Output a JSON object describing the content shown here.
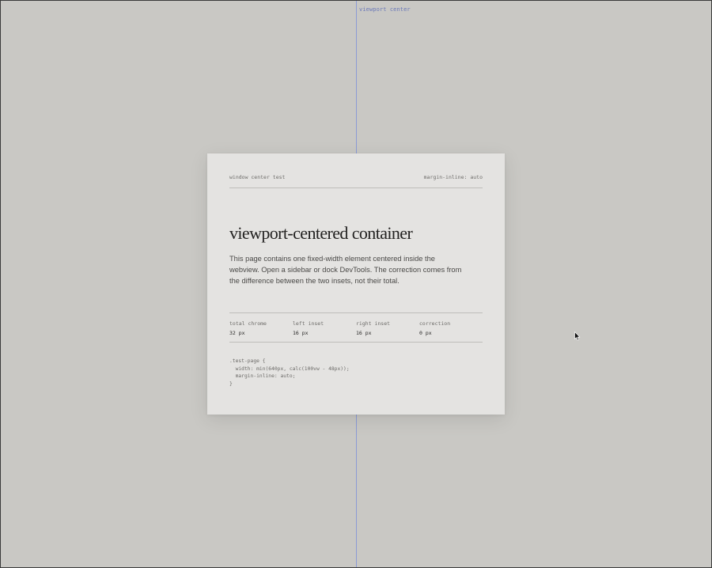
{
  "guide": {
    "label": "viewport center",
    "color": "#8c9bd6"
  },
  "panel": {
    "header_left": "window center test",
    "header_right": "margin-inline: auto",
    "title": "viewport-centered container",
    "description": "This page contains one fixed-width element centered inside the webview. Open a sidebar or dock DevTools. The correction comes from the difference between the two insets, not their total.",
    "stats": [
      {
        "label": "total chrome",
        "value": "32 px"
      },
      {
        "label": "left inset",
        "value": "16 px"
      },
      {
        "label": "right inset",
        "value": "16 px"
      },
      {
        "label": "correction",
        "value": "0 px"
      }
    ],
    "code_lines": [
      ".test-page {",
      "  width: min(640px, calc(100vw - 48px));",
      "  margin-inline: auto;",
      "}"
    ]
  },
  "icons": {
    "cursor": "mouse-pointer-icon"
  }
}
